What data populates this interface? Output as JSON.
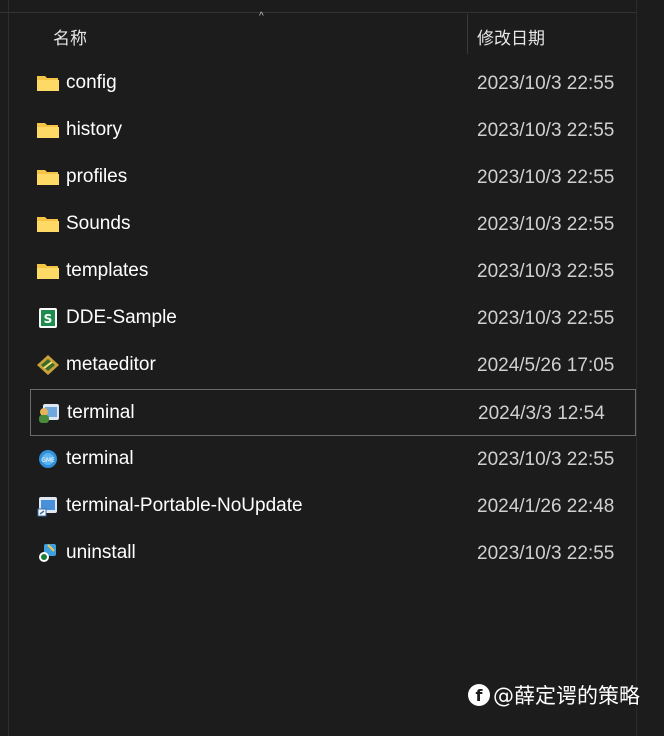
{
  "header": {
    "sort_arrow": "^",
    "col_name": "名称",
    "col_date": "修改日期"
  },
  "files": [
    {
      "name": "config",
      "date": "2023/10/3 22:55",
      "icon": "folder-icon"
    },
    {
      "name": "history",
      "date": "2023/10/3 22:55",
      "icon": "folder-icon"
    },
    {
      "name": "profiles",
      "date": "2023/10/3 22:55",
      "icon": "folder-icon"
    },
    {
      "name": "Sounds",
      "date": "2023/10/3 22:55",
      "icon": "folder-icon"
    },
    {
      "name": "templates",
      "date": "2023/10/3 22:55",
      "icon": "folder-icon"
    },
    {
      "name": "DDE-Sample",
      "date": "2023/10/3 22:55",
      "icon": "spreadsheet-icon"
    },
    {
      "name": "metaeditor",
      "date": "2024/5/26 17:05",
      "icon": "metaeditor-icon"
    },
    {
      "name": "terminal",
      "date": "2024/3/3 12:54",
      "icon": "terminal-app-icon",
      "selected": true
    },
    {
      "name": "terminal",
      "date": "2023/10/3 22:55",
      "icon": "terminal-blue-icon"
    },
    {
      "name": "terminal-Portable-NoUpdate",
      "date": "2024/1/26 22:48",
      "icon": "terminal-shortcut-icon"
    },
    {
      "name": "uninstall",
      "date": "2023/10/3 22:55",
      "icon": "uninstall-icon"
    }
  ],
  "watermark": {
    "logo": "f",
    "text": "@薛定谔的策略"
  },
  "colors": {
    "background": "#1c1c1c",
    "folder": "#f6c445",
    "selection_border": "#6b6b6b"
  }
}
